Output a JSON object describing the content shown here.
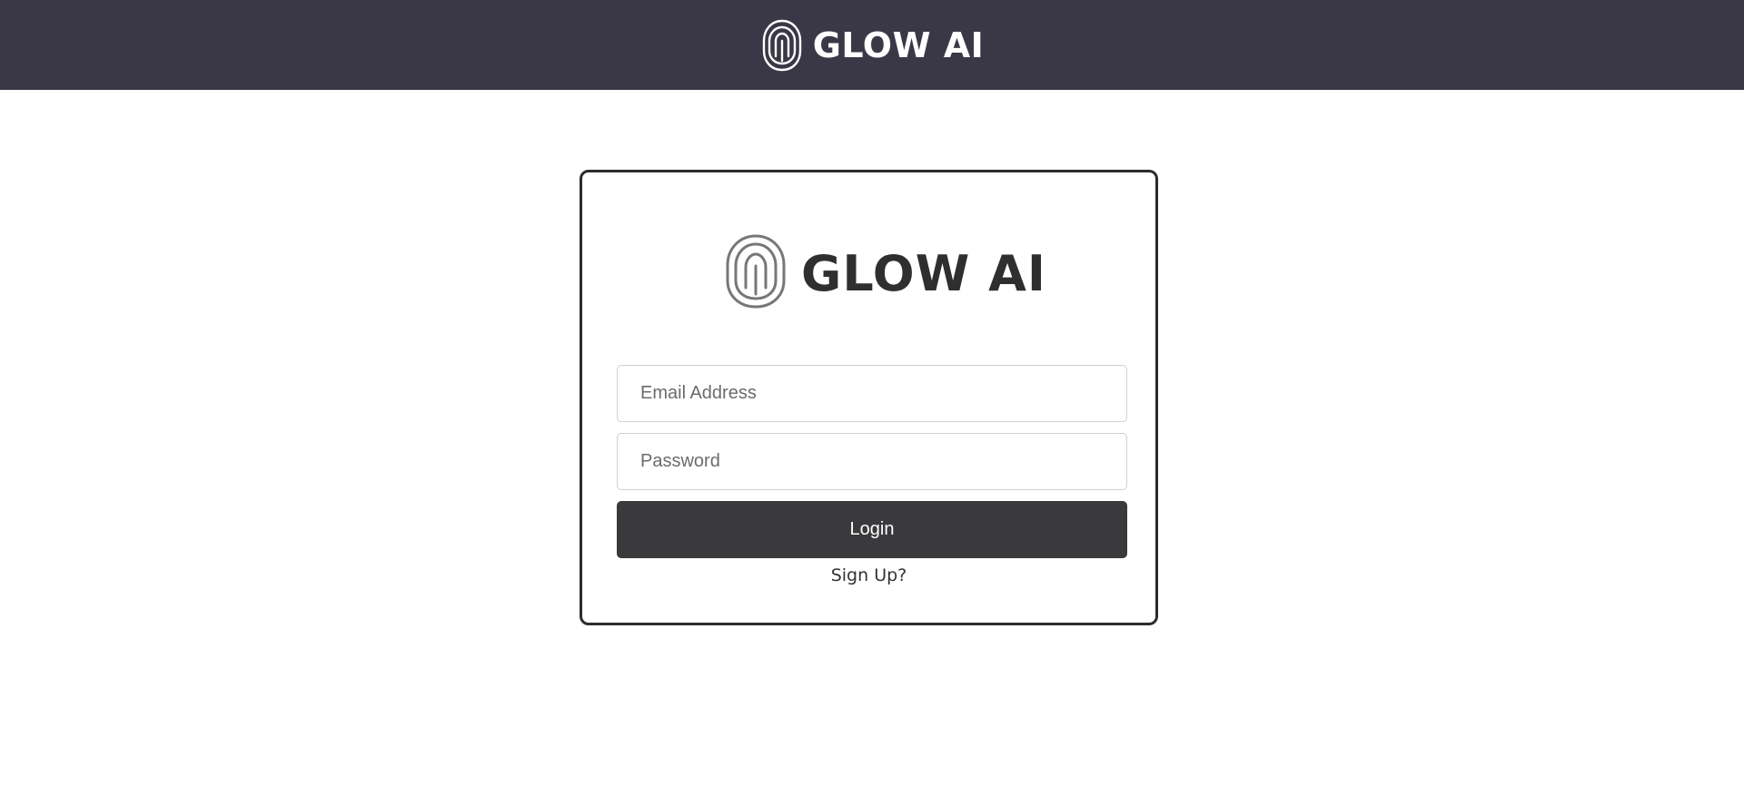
{
  "header": {
    "brand_name": "GLOW AI",
    "logo_icon": "fingerprint-loop-icon",
    "background_color": "#3a3846",
    "text_color": "#ffffff"
  },
  "login_card": {
    "brand_name": "GLOW AI",
    "logo_icon": "fingerprint-loop-icon",
    "email": {
      "placeholder": "Email Address",
      "value": ""
    },
    "password": {
      "placeholder": "Password",
      "value": ""
    },
    "login_label": "Login",
    "signup_label": "Sign Up?",
    "button_color": "#3a393c",
    "border_color": "#2c2c2e"
  }
}
